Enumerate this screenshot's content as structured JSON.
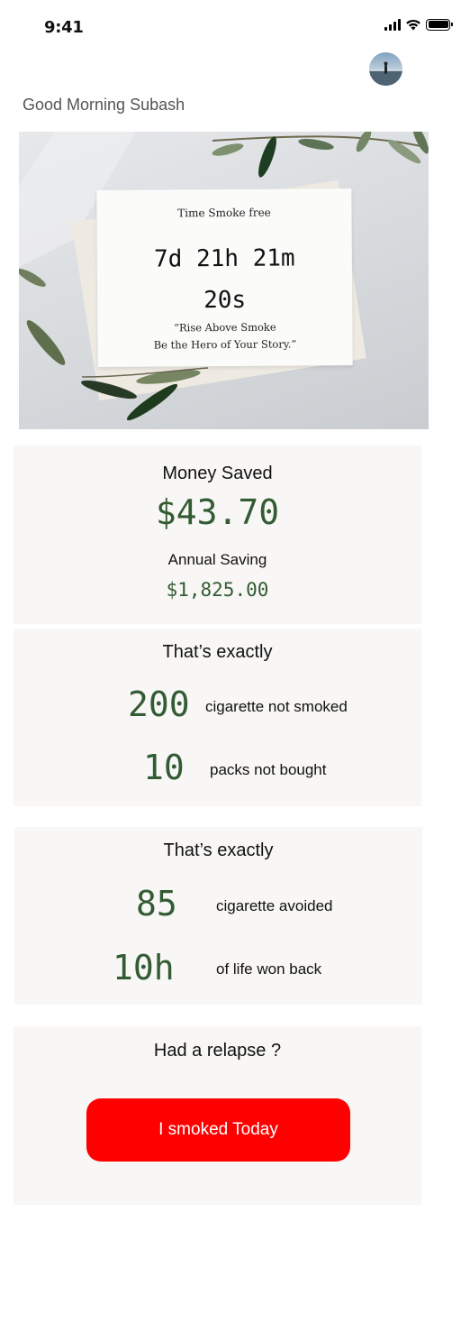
{
  "status_bar": {
    "time": "9:41"
  },
  "header": {
    "greeting": "Good Morning Subash"
  },
  "hero": {
    "title": "Time Smoke free",
    "timer_line1": "7d 21h 21m",
    "timer_line2": "20s",
    "quote_line1": "“Rise Above Smoke",
    "quote_line2": "Be the Hero of Your Story.”"
  },
  "money": {
    "title": "Money Saved",
    "value": "$43.70",
    "annual_title": "Annual Saving",
    "annual_value": "$1,825.00"
  },
  "stats_one": {
    "heading": "That’s exactly",
    "items": [
      {
        "value": "200",
        "label": "cigarette not smoked"
      },
      {
        "value": "10",
        "label": "packs not bought"
      }
    ]
  },
  "stats_two": {
    "heading": "That’s exactly",
    "items": [
      {
        "value": "85",
        "label": "cigarette avoided"
      },
      {
        "value": "10h",
        "label": "of life won back"
      }
    ]
  },
  "relapse": {
    "title": "Had a relapse ?",
    "button_label": "I smoked Today"
  },
  "colors": {
    "accent_green": "#335b34",
    "button_red": "#fe0000",
    "panel_bg": "#f8f7f5"
  },
  "icons": [
    "signal-icon",
    "wifi-icon",
    "battery-icon",
    "avatar"
  ]
}
